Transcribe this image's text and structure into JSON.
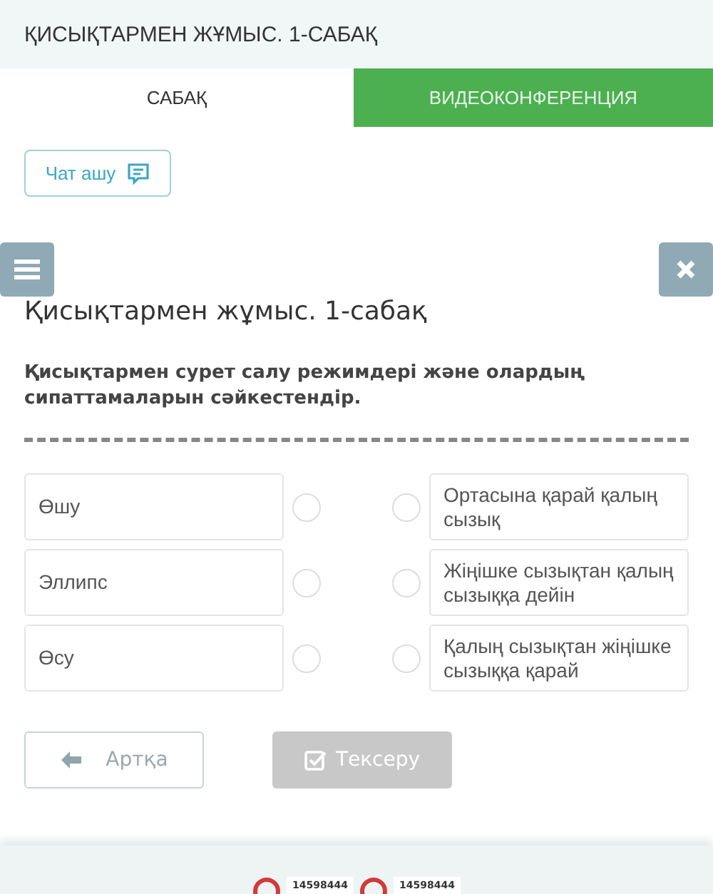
{
  "header": {
    "title": "ҚИСЫҚТАРМЕН ЖҰМЫС. 1-САБАҚ"
  },
  "tabs": [
    {
      "label": "САБАҚ",
      "selected": true
    },
    {
      "label": "ВИДЕОКОНФЕРЕНЦИЯ",
      "selected": false
    }
  ],
  "chat_button": {
    "label": "Чат ашу"
  },
  "lesson_title": "Қисықтармен жұмыс. 1-сабақ",
  "question": "Қисықтармен сурет салу режимдері және олардың сипаттамаларын сәйкестендір.",
  "left_items": [
    {
      "label": "Өшу",
      "selected": false
    },
    {
      "label": "Эллипс",
      "selected": false
    },
    {
      "label": "Өсу",
      "selected": false
    }
  ],
  "right_items": [
    {
      "label": "Ортасына қарай қалың сызық",
      "selected": false
    },
    {
      "label": "Жіңішке сызықтан қалың сызыққа дейін",
      "selected": false
    },
    {
      "label": "Қалың сызықтан жіңішке сызыққа қарай",
      "selected": false
    }
  ],
  "back_button": {
    "label": "Артқа"
  },
  "check_button": {
    "label": "Тексеру",
    "disabled": true
  },
  "footer_counters": [
    "14598444",
    "14598444"
  ]
}
